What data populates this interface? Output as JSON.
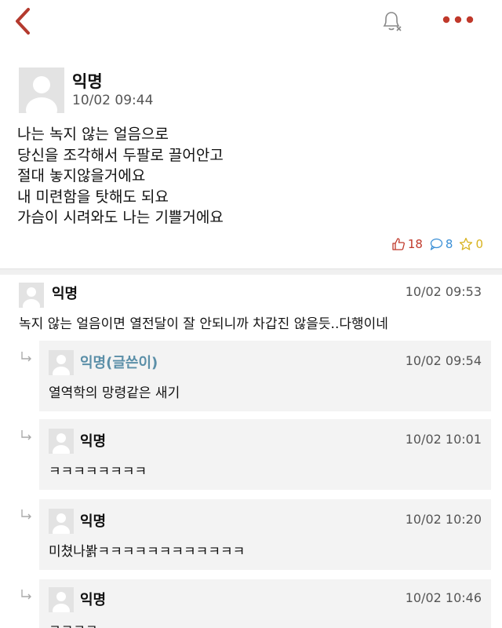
{
  "header": {
    "back_icon": "chevron-left-icon",
    "notification_icon": "bell-off-icon",
    "more_icon": "more-dots-icon",
    "accent_color": "#b43a2e"
  },
  "post": {
    "author": "익명",
    "time": "10/02 09:44",
    "body_lines": [
      "나는 녹지 않는 얼음으로",
      "당신을 조각해서 두팔로 끌어안고",
      "절대 놓지않을거에요",
      "내 미련함을 탓해도 되요",
      "가슴이 시려와도 나는 기쁠거에요"
    ],
    "likes": "18",
    "comments": "8",
    "scraps": "0"
  },
  "comments": [
    {
      "author": "익명",
      "time": "10/02 09:53",
      "text": "녹지 않는 얼음이면 열전달이 잘 안되니까 차갑진 않을듯..다행이네"
    }
  ],
  "replies": [
    {
      "author": "익명(글쓴이)",
      "time": "10/02 09:54",
      "text": "열역학의 망령같은 새기",
      "is_op": true
    },
    {
      "author": "익명",
      "time": "10/02 10:01",
      "text": "ㅋㅋㅋㅋㅋㅋㅋㅋ",
      "is_op": false
    },
    {
      "author": "익명",
      "time": "10/02 10:20",
      "text": "미쳤나봙ㅋㅋㅋㅋㅋㅋㅋㅋㅋㅋㅋㅋ",
      "is_op": false
    },
    {
      "author": "익명",
      "time": "10/02 10:46",
      "text": "ㅋㅋㅋㅋ",
      "is_op": false
    }
  ]
}
